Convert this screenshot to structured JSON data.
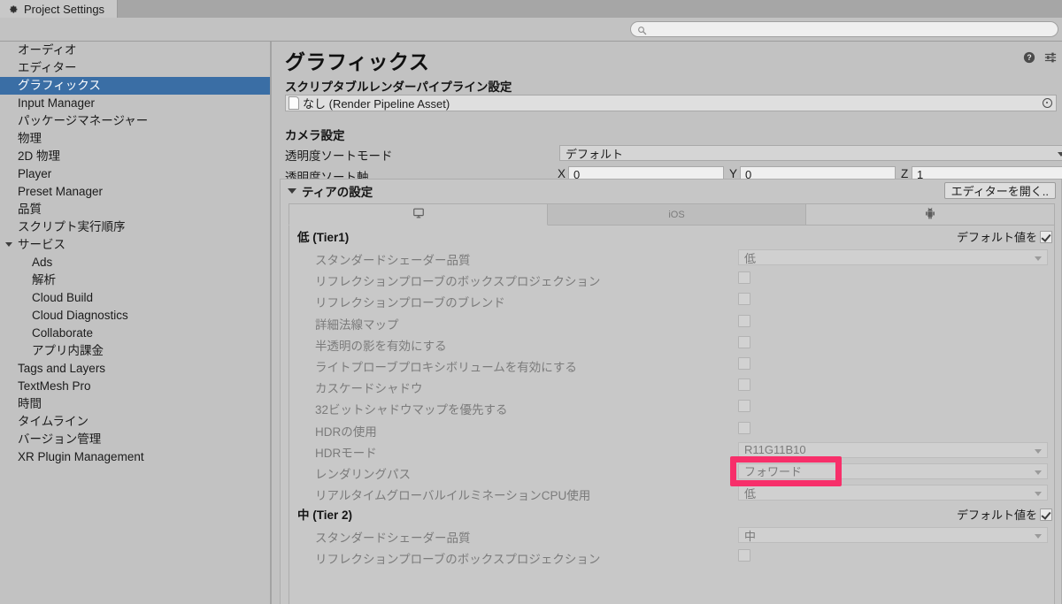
{
  "window": {
    "tab_label": "Project Settings",
    "gear_icon": "gear-icon"
  },
  "search": {
    "value": "",
    "placeholder": "",
    "icon": "search-icon"
  },
  "sidebar": {
    "items": [
      {
        "label": "オーディオ",
        "indent": 0,
        "selected": false,
        "arrow": ""
      },
      {
        "label": "エディター",
        "indent": 0,
        "selected": false,
        "arrow": ""
      },
      {
        "label": "グラフィックス",
        "indent": 0,
        "selected": true,
        "arrow": ""
      },
      {
        "label": "Input Manager",
        "indent": 0,
        "selected": false,
        "arrow": ""
      },
      {
        "label": "パッケージマネージャー",
        "indent": 0,
        "selected": false,
        "arrow": ""
      },
      {
        "label": "物理",
        "indent": 0,
        "selected": false,
        "arrow": ""
      },
      {
        "label": "2D 物理",
        "indent": 0,
        "selected": false,
        "arrow": ""
      },
      {
        "label": "Player",
        "indent": 0,
        "selected": false,
        "arrow": ""
      },
      {
        "label": "Preset Manager",
        "indent": 0,
        "selected": false,
        "arrow": ""
      },
      {
        "label": "品質",
        "indent": 0,
        "selected": false,
        "arrow": ""
      },
      {
        "label": "スクリプト実行順序",
        "indent": 0,
        "selected": false,
        "arrow": ""
      },
      {
        "label": "サービス",
        "indent": 0,
        "selected": false,
        "arrow": "open"
      },
      {
        "label": "Ads",
        "indent": 1,
        "selected": false,
        "arrow": ""
      },
      {
        "label": "解析",
        "indent": 1,
        "selected": false,
        "arrow": ""
      },
      {
        "label": "Cloud Build",
        "indent": 1,
        "selected": false,
        "arrow": ""
      },
      {
        "label": "Cloud Diagnostics",
        "indent": 1,
        "selected": false,
        "arrow": ""
      },
      {
        "label": "Collaborate",
        "indent": 1,
        "selected": false,
        "arrow": ""
      },
      {
        "label": "アプリ内課金",
        "indent": 1,
        "selected": false,
        "arrow": ""
      },
      {
        "label": "Tags and Layers",
        "indent": 0,
        "selected": false,
        "arrow": ""
      },
      {
        "label": "TextMesh Pro",
        "indent": 0,
        "selected": false,
        "arrow": ""
      },
      {
        "label": "時間",
        "indent": 0,
        "selected": false,
        "arrow": ""
      },
      {
        "label": "タイムライン",
        "indent": 0,
        "selected": false,
        "arrow": ""
      },
      {
        "label": "バージョン管理",
        "indent": 0,
        "selected": false,
        "arrow": ""
      },
      {
        "label": "XR Plugin Management",
        "indent": 0,
        "selected": false,
        "arrow": ""
      }
    ]
  },
  "main": {
    "title": "グラフィックス",
    "help_icon": "help-icon",
    "preset_icon": "preset-settings-icon",
    "srp": {
      "heading": "スクリプタブルレンダーパイプライン設定",
      "asset_value": "なし (Render Pipeline Asset)",
      "object_icon": "asset-document-icon",
      "picker_icon": "object-picker-icon"
    },
    "camera": {
      "heading": "カメラ設定",
      "sort_mode_label": "透明度ソートモード",
      "sort_mode_value": "デフォルト",
      "sort_axis_label": "透明度ソート軸",
      "axes": [
        {
          "name": "X",
          "value": "0"
        },
        {
          "name": "Y",
          "value": "0"
        },
        {
          "name": "Z",
          "value": "1"
        }
      ]
    },
    "tier": {
      "heading": "ティアの設定",
      "open_editor_button": "エディターを開く..",
      "platform_tabs": [
        {
          "label": "",
          "icon": "desktop-monitor-icon",
          "state": "active"
        },
        {
          "label": "iOS",
          "icon": "",
          "state": "normal"
        },
        {
          "label": "",
          "icon": "android-robot-icon",
          "state": "light"
        }
      ],
      "default_toggle_label": "デフォルト値を",
      "default_toggle_checked": true,
      "groups": [
        {
          "name": "低 (Tier1)",
          "rows": [
            {
              "label": "スタンダードシェーダー品質",
              "type": "dropdown",
              "value": "低"
            },
            {
              "label": "リフレクションプローブのボックスプロジェクション",
              "type": "checkbox",
              "checked": false
            },
            {
              "label": "リフレクションプローブのブレンド",
              "type": "checkbox",
              "checked": false
            },
            {
              "label": "詳細法線マップ",
              "type": "checkbox",
              "checked": false
            },
            {
              "label": "半透明の影を有効にする",
              "type": "checkbox",
              "checked": false
            },
            {
              "label": "ライトプローブプロキシボリュームを有効にする",
              "type": "checkbox",
              "checked": false
            },
            {
              "label": "カスケードシャドウ",
              "type": "checkbox",
              "checked": false
            },
            {
              "label": "32ビットシャドウマップを優先する",
              "type": "checkbox",
              "checked": false
            },
            {
              "label": "HDRの使用",
              "type": "checkbox",
              "checked": false
            },
            {
              "label": "HDRモード",
              "type": "dropdown",
              "value": "R11G11B10"
            },
            {
              "label": "レンダリングパス",
              "type": "dropdown",
              "value": "フォワード",
              "highlighted": true
            },
            {
              "label": "リアルタイムグローバルイルミネーションCPU使用",
              "type": "dropdown",
              "value": "低"
            }
          ]
        },
        {
          "name": "中 (Tier 2)",
          "rows": [
            {
              "label": "スタンダードシェーダー品質",
              "type": "dropdown",
              "value": "中"
            },
            {
              "label": "リフレクションプローブのボックスプロジェクション",
              "type": "checkbox",
              "checked": false
            }
          ]
        }
      ]
    }
  },
  "annotation": {
    "color": "#f72f6a",
    "target": "レンダリングパス"
  }
}
